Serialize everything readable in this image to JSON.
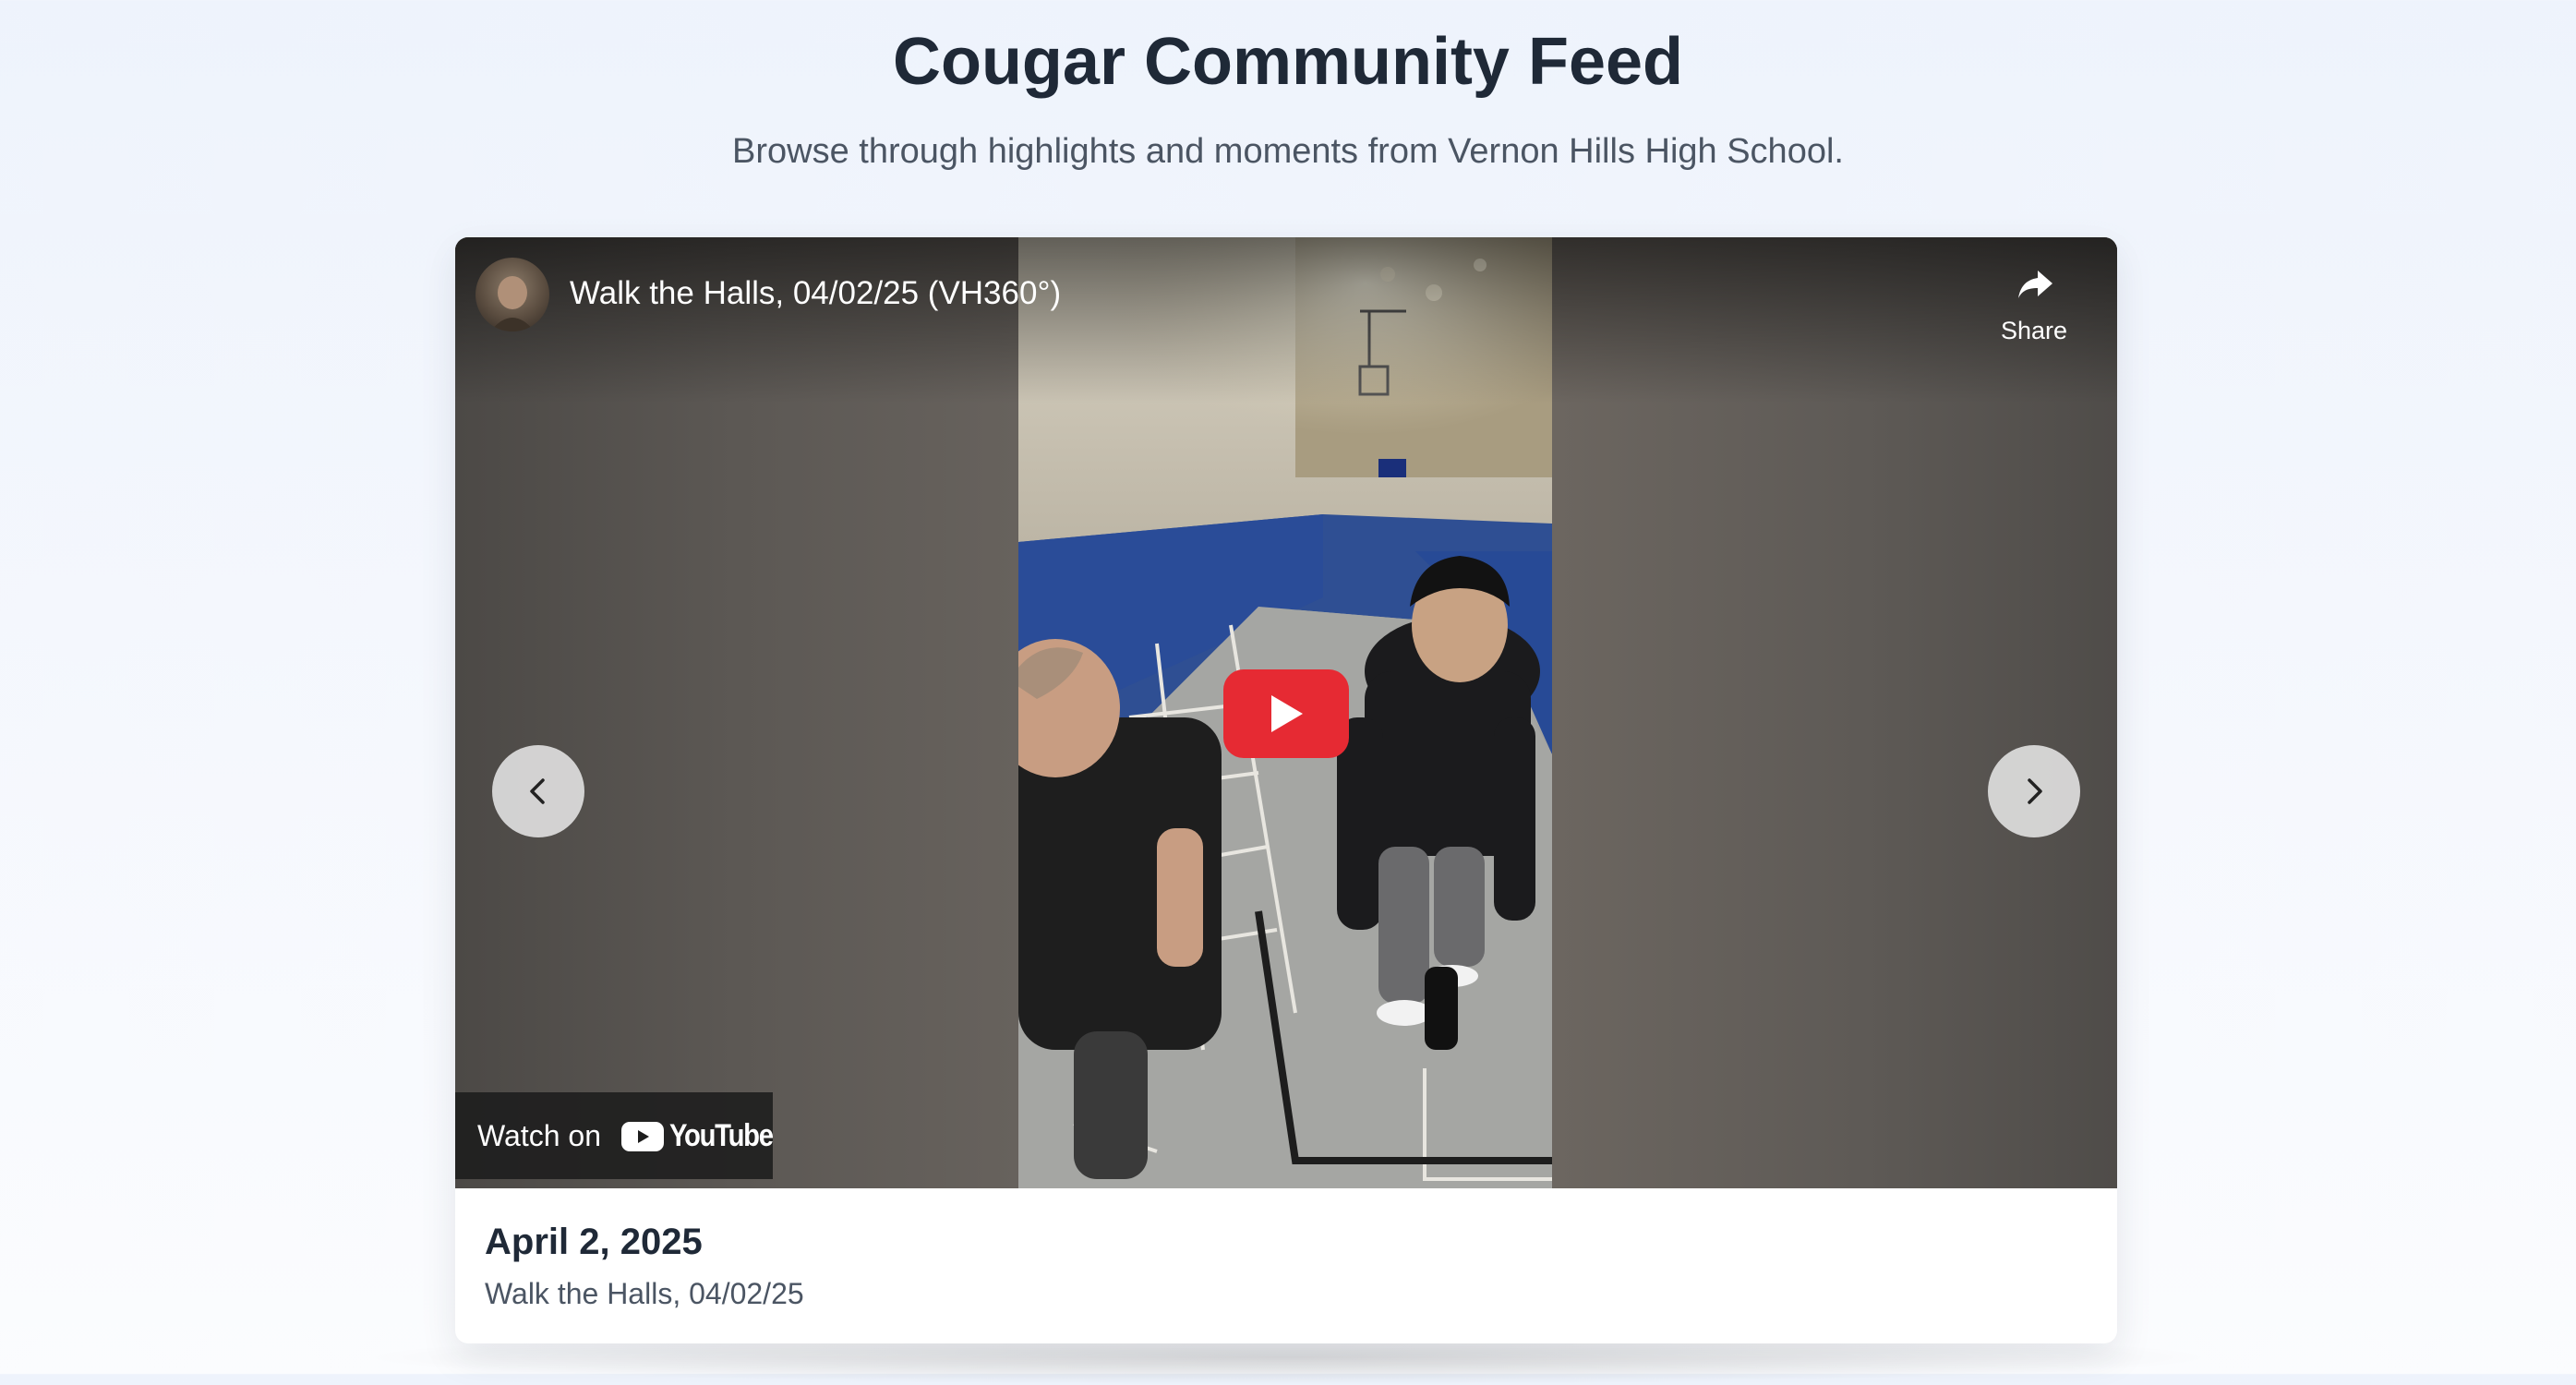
{
  "page": {
    "title": "Cougar Community Feed",
    "subtitle": "Browse through highlights and moments from Vernon Hills High School."
  },
  "video": {
    "title": "Walk the Halls, 04/02/25 (VH360°)",
    "share_label": "Share",
    "watch_on_label": "Watch on",
    "youtube_wordmark": "YouTube",
    "play_button_color": "#e62a33"
  },
  "caption": {
    "date": "April 2, 2025",
    "text": "Walk the Halls, 04/02/25"
  },
  "icons": {
    "share": "share-arrow-icon",
    "prev": "chevron-left-icon",
    "next": "chevron-right-icon",
    "play": "play-icon",
    "youtube": "youtube-logo-icon"
  }
}
